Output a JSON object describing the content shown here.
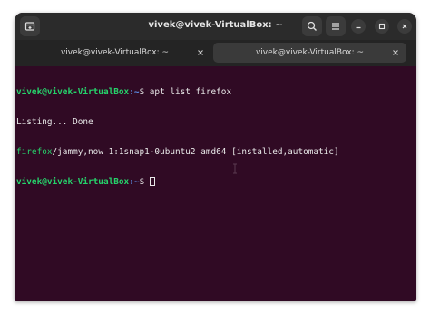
{
  "window": {
    "title": "vivek@vivek-VirtualBox: ~"
  },
  "headerbar": {
    "new_tab_icon": "new-tab-icon",
    "search_icon": "search-icon",
    "menu_icon": "hamburger-menu-icon",
    "minimize_icon": "minimize-icon",
    "maximize_icon": "maximize-icon",
    "close_icon": "close-icon"
  },
  "tabs": [
    {
      "label": "vivek@vivek-VirtualBox: ~",
      "active": false
    },
    {
      "label": "vivek@vivek-VirtualBox: ~",
      "active": true
    }
  ],
  "terminal": {
    "prompt_user": "vivek@vivek-VirtualBox",
    "prompt_path": ":~",
    "prompt_symbol": "$ ",
    "command": "apt list firefox",
    "output_line1": "Listing... Done",
    "pkg_name": "firefox",
    "pkg_rest": "/jammy,now 1:1snap1-0ubuntu2 amd64 [installed,automatic]"
  },
  "colors": {
    "terminal_bg": "#300a24",
    "prompt_green": "#26d36b",
    "path_blue": "#5c8ee8",
    "headerbar_bg": "#2b2b2b"
  }
}
